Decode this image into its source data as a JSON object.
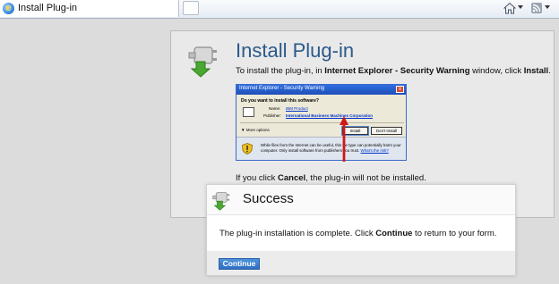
{
  "browser": {
    "tab_title": "Install Plug-in",
    "tab_icon": "ie-icon"
  },
  "panel": {
    "title": "Install Plug-in",
    "instruction_prefix": "To install the plug-in, in ",
    "instruction_window": "Internet Explorer - Security Warning",
    "instruction_middle": " window, click ",
    "instruction_button": "Install",
    "instruction_suffix": ".",
    "cancel_prefix": "If you click ",
    "cancel_word": "Cancel",
    "cancel_suffix": ", the plug-in will not be installed."
  },
  "warning_dialog": {
    "title": "Internet Explorer - Security Warning",
    "close": "x",
    "question": "Do you want to install this software?",
    "name_label": "Name:",
    "name_value": "IBM Product",
    "publisher_label": "Publisher:",
    "publisher_value": "International Business Machines Corporation",
    "more_options": "More options",
    "install_button": "Install",
    "dont_install_button": "Don't Install",
    "warning_text": "While files from the Internet can be useful, this file type can potentially harm your computer. Only install software from publishers you trust.",
    "warning_link": "What's the risk?"
  },
  "success_dialog": {
    "title": "Success",
    "message_prefix": "The plug-in installation is complete. Click ",
    "message_bold": "Continue",
    "message_suffix": " to return to your form.",
    "continue_button": "Continue"
  },
  "colors": {
    "title_blue": "#2a5a8a",
    "accent_blue": "#3a86d6",
    "arrow_red": "#d01818",
    "plug_green": "#4aa832"
  }
}
